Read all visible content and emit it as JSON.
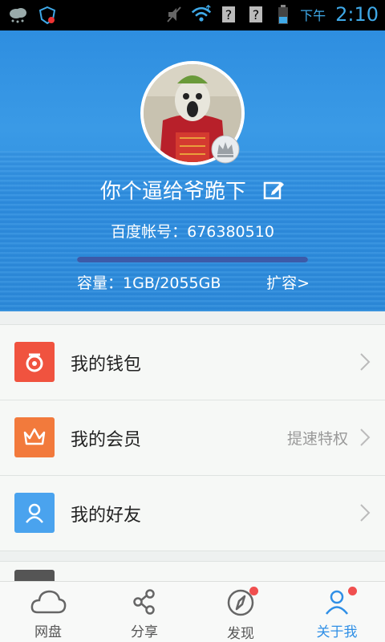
{
  "status_bar": {
    "ampm": "下午",
    "time": "2:10"
  },
  "profile": {
    "name": "你个逼给爷跪下",
    "account_label": "百度帐号：",
    "account_id": "676380510",
    "capacity_label": "容量：",
    "capacity_value": "1GB/2055GB",
    "usage_fraction": 0.0005,
    "expand_label": "扩容>"
  },
  "menu": {
    "wallet": {
      "label": "我的钱包",
      "icon": "wallet-icon",
      "color": "#f0533f"
    },
    "membership": {
      "label": "我的会员",
      "extra": "提速特权",
      "icon": "crown-icon",
      "color": "#f27a3c"
    },
    "friends": {
      "label": "我的好友",
      "icon": "person-icon",
      "color": "#4aa3ee"
    }
  },
  "tabs": {
    "cloud": "网盘",
    "share": "分享",
    "discover": "发现",
    "me": "关于我"
  },
  "colors": {
    "accent": "#2f8fe6",
    "badge": "#f04f4f"
  }
}
